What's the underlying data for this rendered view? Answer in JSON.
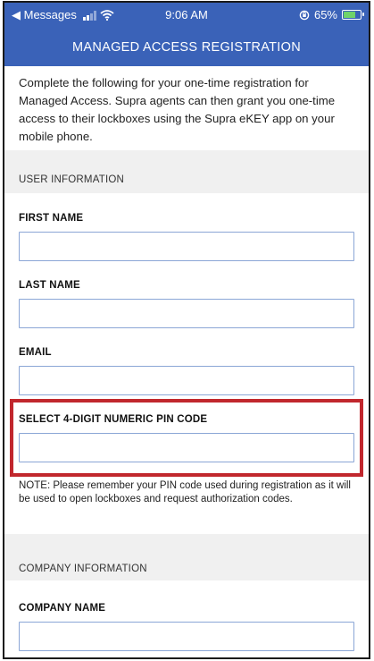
{
  "status_bar": {
    "back_app": "◀ Messages",
    "time": "9:06 AM",
    "battery_percent": "65%",
    "signal_bars": 4,
    "signal_active": 2
  },
  "header": {
    "title": "MANAGED ACCESS REGISTRATION"
  },
  "intro_text": "Complete the following for your one-time registration for Managed Access. Supra agents can then grant you one-time access to their lockboxes using the Supra eKEY app on your mobile phone.",
  "user_section": {
    "label": "USER INFORMATION",
    "fields": {
      "first_name": {
        "label": "FIRST NAME",
        "value": ""
      },
      "last_name": {
        "label": "LAST NAME",
        "value": ""
      },
      "email": {
        "label": "EMAIL",
        "value": ""
      },
      "pin": {
        "label": "SELECT 4-DIGIT NUMERIC PIN CODE",
        "value": ""
      }
    },
    "note": "NOTE: Please remember your PIN code used during registration as it will be used to open lockboxes and request authorization codes."
  },
  "company_section": {
    "label": "COMPANY INFORMATION",
    "fields": {
      "company_name": {
        "label": "COMPANY NAME",
        "value": ""
      }
    }
  },
  "colors": {
    "header_bg": "#3a62b8",
    "highlight": "#c1272d",
    "input_border": "#8ba6d6"
  }
}
